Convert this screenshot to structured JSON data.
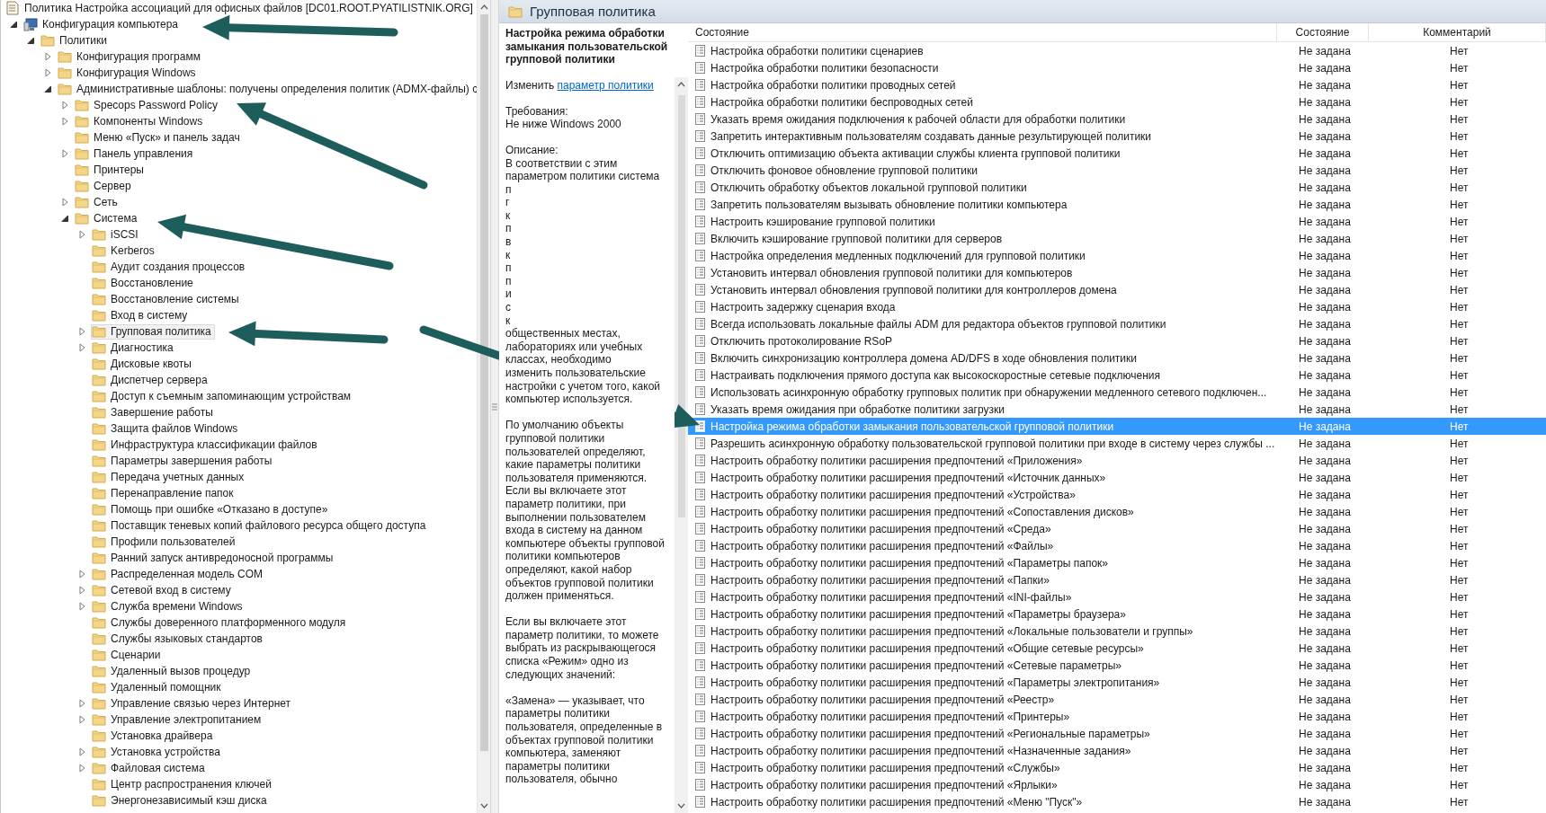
{
  "tree": {
    "title": "Политика Настройка ассоциаций для офисных файлов [DC01.ROOT.PYATILISTNIK.ORG]",
    "items": [
      {
        "label": "Конфигурация компьютера",
        "kind": "computer",
        "expandable": true,
        "expanded": true,
        "selected": false,
        "children": [
          {
            "label": "Политики",
            "kind": "folder",
            "expandable": true,
            "expanded": true,
            "selected": false,
            "children": [
              {
                "label": "Конфигурация программ",
                "kind": "folder",
                "expandable": true,
                "expanded": false,
                "selected": false
              },
              {
                "label": "Конфигурация Windows",
                "kind": "folder",
                "expandable": true,
                "expanded": false,
                "selected": false
              },
              {
                "label": "Административные шаблоны: получены определения политик (ADMX-файлы) с",
                "kind": "folder",
                "expandable": true,
                "expanded": true,
                "selected": false,
                "children": [
                  {
                    "label": "Specops Password Policy",
                    "kind": "folder",
                    "expandable": true,
                    "expanded": false,
                    "selected": false
                  },
                  {
                    "label": "Компоненты Windows",
                    "kind": "folder",
                    "expandable": true,
                    "expanded": false,
                    "selected": false
                  },
                  {
                    "label": "Меню «Пуск» и панель задач",
                    "kind": "folder",
                    "expandable": false,
                    "selected": false
                  },
                  {
                    "label": "Панель управления",
                    "kind": "folder",
                    "expandable": true,
                    "expanded": false,
                    "selected": false
                  },
                  {
                    "label": "Принтеры",
                    "kind": "folder",
                    "expandable": false,
                    "selected": false
                  },
                  {
                    "label": "Сервер",
                    "kind": "folder",
                    "expandable": false,
                    "selected": false
                  },
                  {
                    "label": "Сеть",
                    "kind": "folder",
                    "expandable": true,
                    "expanded": false,
                    "selected": false
                  },
                  {
                    "label": "Система",
                    "kind": "folder",
                    "expandable": true,
                    "expanded": true,
                    "selected": false,
                    "children": [
                      {
                        "label": "iSCSI",
                        "kind": "folder",
                        "expandable": true,
                        "expanded": false,
                        "selected": false
                      },
                      {
                        "label": "Kerberos",
                        "kind": "folder",
                        "expandable": false,
                        "selected": false
                      },
                      {
                        "label": "Аудит создания процессов",
                        "kind": "folder",
                        "expandable": false,
                        "selected": false
                      },
                      {
                        "label": "Восстановление",
                        "kind": "folder",
                        "expandable": false,
                        "selected": false
                      },
                      {
                        "label": "Восстановление системы",
                        "kind": "folder",
                        "expandable": false,
                        "selected": false
                      },
                      {
                        "label": "Вход в систему",
                        "kind": "folder",
                        "expandable": false,
                        "selected": false
                      },
                      {
                        "label": "Групповая политика",
                        "kind": "folder",
                        "expandable": true,
                        "expanded": false,
                        "selected": true
                      },
                      {
                        "label": "Диагностика",
                        "kind": "folder",
                        "expandable": true,
                        "expanded": false,
                        "selected": false
                      },
                      {
                        "label": "Дисковые квоты",
                        "kind": "folder",
                        "expandable": false,
                        "selected": false
                      },
                      {
                        "label": "Диспетчер сервера",
                        "kind": "folder",
                        "expandable": false,
                        "selected": false
                      },
                      {
                        "label": "Доступ к съемным запоминающим устройствам",
                        "kind": "folder",
                        "expandable": false,
                        "selected": false
                      },
                      {
                        "label": "Завершение работы",
                        "kind": "folder",
                        "expandable": false,
                        "selected": false
                      },
                      {
                        "label": "Защита файлов Windows",
                        "kind": "folder",
                        "expandable": false,
                        "selected": false
                      },
                      {
                        "label": "Инфраструктура классификации файлов",
                        "kind": "folder",
                        "expandable": false,
                        "selected": false
                      },
                      {
                        "label": "Параметры завершения работы",
                        "kind": "folder",
                        "expandable": false,
                        "selected": false
                      },
                      {
                        "label": "Передача учетных данных",
                        "kind": "folder",
                        "expandable": false,
                        "selected": false
                      },
                      {
                        "label": "Перенаправление папок",
                        "kind": "folder",
                        "expandable": false,
                        "selected": false
                      },
                      {
                        "label": "Помощь при ошибке «Отказано в доступе»",
                        "kind": "folder",
                        "expandable": false,
                        "selected": false
                      },
                      {
                        "label": "Поставщик теневых копий файлового ресурса общего доступа",
                        "kind": "folder",
                        "expandable": false,
                        "selected": false
                      },
                      {
                        "label": "Профили пользователей",
                        "kind": "folder",
                        "expandable": false,
                        "selected": false
                      },
                      {
                        "label": "Ранний запуск антивредоносной программы",
                        "kind": "folder",
                        "expandable": false,
                        "selected": false
                      },
                      {
                        "label": "Распределенная модель COM",
                        "kind": "folder",
                        "expandable": true,
                        "expanded": false,
                        "selected": false
                      },
                      {
                        "label": "Сетевой вход в систему",
                        "kind": "folder",
                        "expandable": true,
                        "expanded": false,
                        "selected": false
                      },
                      {
                        "label": "Служба времени Windows",
                        "kind": "folder",
                        "expandable": true,
                        "expanded": false,
                        "selected": false
                      },
                      {
                        "label": "Службы доверенного платформенного модуля",
                        "kind": "folder",
                        "expandable": false,
                        "selected": false
                      },
                      {
                        "label": "Службы языковых стандартов",
                        "kind": "folder",
                        "expandable": false,
                        "selected": false
                      },
                      {
                        "label": "Сценарии",
                        "kind": "folder",
                        "expandable": false,
                        "selected": false
                      },
                      {
                        "label": "Удаленный вызов процедур",
                        "kind": "folder",
                        "expandable": false,
                        "selected": false
                      },
                      {
                        "label": "Удаленный помощник",
                        "kind": "folder",
                        "expandable": false,
                        "selected": false
                      },
                      {
                        "label": "Управление связью через Интернет",
                        "kind": "folder",
                        "expandable": true,
                        "expanded": false,
                        "selected": false
                      },
                      {
                        "label": "Управление электропитанием",
                        "kind": "folder",
                        "expandable": true,
                        "expanded": false,
                        "selected": false
                      },
                      {
                        "label": "Установка драйвера",
                        "kind": "folder",
                        "expandable": false,
                        "selected": false
                      },
                      {
                        "label": "Установка устройства",
                        "kind": "folder",
                        "expandable": true,
                        "expanded": false,
                        "selected": false
                      },
                      {
                        "label": "Файловая система",
                        "kind": "folder",
                        "expandable": true,
                        "expanded": false,
                        "selected": false
                      },
                      {
                        "label": "Центр распространения ключей",
                        "kind": "folder",
                        "expandable": false,
                        "selected": false
                      },
                      {
                        "label": "Энергонезависимый кэш диска",
                        "kind": "folder",
                        "expandable": false,
                        "selected": false
                      }
                    ]
                  }
                ]
              }
            ]
          }
        ]
      }
    ]
  },
  "details": {
    "header": "Групповая политика",
    "policy_title": "Настройка режима обработки замыкания пользовательской групповой политики",
    "edit_prefix": "Изменить",
    "edit_link": "параметр политики",
    "requirements_label": "Требования:",
    "requirements": "Не ниже Windows 2000",
    "description_label": "Описание:",
    "description": [
      [
        "В соответствии с этим",
        "параметром политики система",
        "п",
        "г",
        "к",
        "п",
        "в",
        "к",
        "п",
        "п",
        "и",
        "с",
        "к",
        "общественных местах,",
        "лабораториях или учебных",
        "классах, необходимо",
        "изменить пользовательские",
        "настройки с учетом того, какой",
        "компьютер используется."
      ],
      [
        "По умолчанию объекты",
        "групповой политики",
        "пользователей определяют,",
        "какие параметры политики",
        "пользователя применяются.",
        "Если вы включаете этот",
        "параметр политики, при",
        "выполнении пользователем",
        "входа в систему на данном",
        "компьютере объекты групповой",
        "политики компьютеров",
        "определяют, какой набор",
        "объектов групповой политики",
        "должен применяться."
      ],
      [
        "Если вы включаете этот",
        "параметр политики, то можете",
        "выбрать из раскрывающегося",
        "списка «Режим» одно из",
        "следующих значений:"
      ],
      [
        "«Замена» — указывает, что",
        "параметры политики",
        "пользователя, определенные в",
        "объектах групповой политики",
        "компьютера, заменяют",
        "параметры политики",
        "пользователя, обычно"
      ]
    ]
  },
  "table": {
    "columns": [
      "Состояние",
      "Состояние",
      "Комментарий"
    ],
    "rows": [
      {
        "name": "Настройка обработки политики сценариев",
        "state": "Не задана",
        "comment": "Нет",
        "selected": false
      },
      {
        "name": "Настройка обработки политики безопасности",
        "state": "Не задана",
        "comment": "Нет",
        "selected": false
      },
      {
        "name": "Настройка обработки политики проводных сетей",
        "state": "Не задана",
        "comment": "Нет",
        "selected": false
      },
      {
        "name": "Настройка обработки политики беспроводных сетей",
        "state": "Не задана",
        "comment": "Нет",
        "selected": false
      },
      {
        "name": "Указать время ожидания подключения к рабочей области для обработки политики",
        "state": "Не задана",
        "comment": "Нет",
        "selected": false
      },
      {
        "name": "Запретить интерактивным пользователям создавать данные результирующей политики",
        "state": "Не задана",
        "comment": "Нет",
        "selected": false
      },
      {
        "name": "Отключить оптимизацию объекта активации службы клиента групповой политики",
        "state": "Не задана",
        "comment": "Нет",
        "selected": false
      },
      {
        "name": "Отключить фоновое обновление групповой политики",
        "state": "Не задана",
        "comment": "Нет",
        "selected": false
      },
      {
        "name": "Отключить обработку объектов локальной групповой политики",
        "state": "Не задана",
        "comment": "Нет",
        "selected": false
      },
      {
        "name": "Запретить пользователям вызывать обновление политики компьютера",
        "state": "Не задана",
        "comment": "Нет",
        "selected": false
      },
      {
        "name": "Настроить кэширование групповой политики",
        "state": "Не задана",
        "comment": "Нет",
        "selected": false
      },
      {
        "name": "Включить кэширование групповой политики для серверов",
        "state": "Не задана",
        "comment": "Нет",
        "selected": false
      },
      {
        "name": "Настройка определения медленных подключений для групповой политики",
        "state": "Не задана",
        "comment": "Нет",
        "selected": false
      },
      {
        "name": "Установить интервал обновления групповой политики для компьютеров",
        "state": "Не задана",
        "comment": "Нет",
        "selected": false
      },
      {
        "name": "Установить интервал обновления групповой политики для контроллеров домена",
        "state": "Не задана",
        "comment": "Нет",
        "selected": false
      },
      {
        "name": "Настроить задержку сценария входа",
        "state": "Не задана",
        "comment": "Нет",
        "selected": false
      },
      {
        "name": "Всегда использовать локальные файлы ADM для редактора объектов групповой политики",
        "state": "Не задана",
        "comment": "Нет",
        "selected": false
      },
      {
        "name": "Отключить протоколирование RSoP",
        "state": "Не задана",
        "comment": "Нет",
        "selected": false
      },
      {
        "name": "Включить синхронизацию контроллера домена AD/DFS в ходе обновления политики",
        "state": "Не задана",
        "comment": "Нет",
        "selected": false
      },
      {
        "name": "Настраивать подключения прямого доступа как высокоскоростные сетевые подключения",
        "state": "Не задана",
        "comment": "Нет",
        "selected": false
      },
      {
        "name": "Использовать асинхронную обработку групповых политик при обнаружении медленного сетевого подключен...",
        "state": "Не задана",
        "comment": "Нет",
        "selected": false
      },
      {
        "name": "Указать время ожидания при обработке политики загрузки",
        "state": "Не задана",
        "comment": "Нет",
        "selected": false
      },
      {
        "name": "Настройка режима обработки замыкания пользовательской групповой политики",
        "state": "Не задана",
        "comment": "Нет",
        "selected": true
      },
      {
        "name": "Разрешить асинхронную обработку пользовательской групповой политики при входе в систему через службы ...",
        "state": "Не задана",
        "comment": "Нет",
        "selected": false
      },
      {
        "name": "Настроить обработку политики расширения предпочтений «Приложения»",
        "state": "Не задана",
        "comment": "Нет",
        "selected": false
      },
      {
        "name": "Настроить обработку политики расширения предпочтений «Источник данных»",
        "state": "Не задана",
        "comment": "Нет",
        "selected": false
      },
      {
        "name": "Настроить обработку политики расширения предпочтений «Устройства»",
        "state": "Не задана",
        "comment": "Нет",
        "selected": false
      },
      {
        "name": "Настроить обработку политики расширения предпочтений «Сопоставления дисков»",
        "state": "Не задана",
        "comment": "Нет",
        "selected": false
      },
      {
        "name": "Настроить обработку политики расширения предпочтений «Среда»",
        "state": "Не задана",
        "comment": "Нет",
        "selected": false
      },
      {
        "name": "Настроить обработку политики расширения предпочтений «Файлы»",
        "state": "Не задана",
        "comment": "Нет",
        "selected": false
      },
      {
        "name": "Настроить обработку политики расширения предпочтений «Параметры папок»",
        "state": "Не задана",
        "comment": "Нет",
        "selected": false
      },
      {
        "name": "Настроить обработку политики расширения предпочтений «Папки»",
        "state": "Не задана",
        "comment": "Нет",
        "selected": false
      },
      {
        "name": "Настроить обработку политики расширения предпочтений «INI-файлы»",
        "state": "Не задана",
        "comment": "Нет",
        "selected": false
      },
      {
        "name": "Настроить обработку политики расширения предпочтений «Параметры браузера»",
        "state": "Не задана",
        "comment": "Нет",
        "selected": false
      },
      {
        "name": "Настроить обработку политики расширения предпочтений «Локальные пользователи и группы»",
        "state": "Не задана",
        "comment": "Нет",
        "selected": false
      },
      {
        "name": "Настроить обработку политики расширения предпочтений «Общие сетевые ресурсы»",
        "state": "Не задана",
        "comment": "Нет",
        "selected": false
      },
      {
        "name": "Настроить обработку политики расширения предпочтений «Сетевые параметры»",
        "state": "Не задана",
        "comment": "Нет",
        "selected": false
      },
      {
        "name": "Настроить обработку политики расширения предпочтений «Параметры электропитания»",
        "state": "Не задана",
        "comment": "Нет",
        "selected": false
      },
      {
        "name": "Настроить обработку политики расширения предпочтений «Реестр»",
        "state": "Не задана",
        "comment": "Нет",
        "selected": false
      },
      {
        "name": "Настроить обработку политики расширения предпочтений «Принтеры»",
        "state": "Не задана",
        "comment": "Нет",
        "selected": false
      },
      {
        "name": "Настроить обработку политики расширения предпочтений «Региональные параметры»",
        "state": "Не задана",
        "comment": "Нет",
        "selected": false
      },
      {
        "name": "Настроить обработку политики расширения предпочтений «Назначенные задания»",
        "state": "Не задана",
        "comment": "Нет",
        "selected": false
      },
      {
        "name": "Настроить обработку политики расширения предпочтений «Службы»",
        "state": "Не задана",
        "comment": "Нет",
        "selected": false
      },
      {
        "name": "Настроить обработку политики расширения предпочтений «Ярлыки»",
        "state": "Не задана",
        "comment": "Нет",
        "selected": false
      },
      {
        "name": "Настроить обработку политики расширения предпочтений «Меню \"Пуск\"»",
        "state": "Не задана",
        "comment": "Нет",
        "selected": false
      }
    ]
  }
}
